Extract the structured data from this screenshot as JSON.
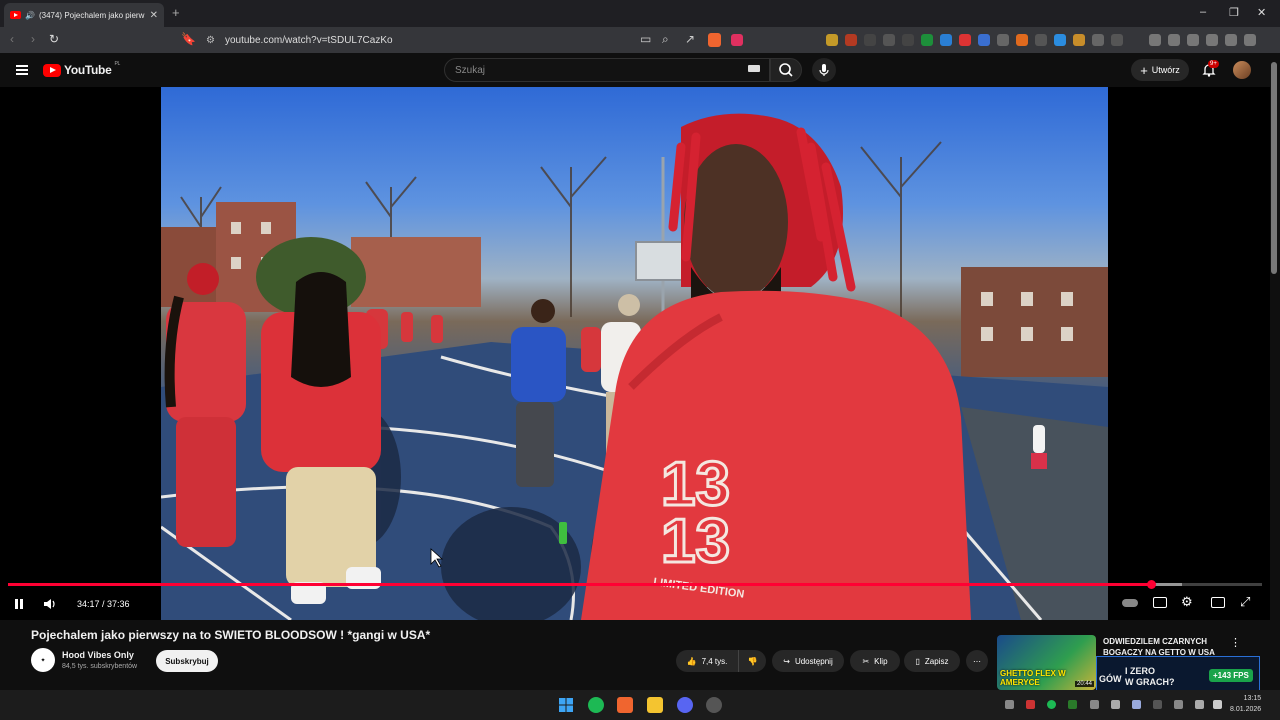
{
  "browser": {
    "tab_title": "(3474) Pojechalem jako pierw",
    "url": "youtube.com/watch?v=tSDUL7CazKo",
    "new_tab_icon": "plus-icon"
  },
  "youtube": {
    "logo_text": "YouTube",
    "logo_region": "PL",
    "search_placeholder": "Szukaj",
    "create_label": "Utwórz",
    "notification_badge": "9+"
  },
  "player": {
    "current_time": "34:17",
    "duration": "37:36",
    "time_display": "34:17 / 37:36",
    "progress_fraction": 0.9118,
    "buffered_fraction": 0.936,
    "jersey_text": "13",
    "shirt_tag": "LIMITED EDITION"
  },
  "video": {
    "title": "Pojechalem jako pierwszy na to SWIETO BLOODSOW ! *gangi w USA*",
    "channel_name": "Hood Vibes Only",
    "subscribers": "84,5 tys. subskrybentów",
    "subscribe_label": "Subskrybuj",
    "likes": "7,4 tys.",
    "share_label": "Udostępnij",
    "clip_label": "Klip",
    "save_label": "Zapisz"
  },
  "recommendation": {
    "title": "ODWIEDZILEM CZARNYCH BOGACZY NA GETTO W USA",
    "thumb_caption": "GHETTO FLEX W AMERYCE",
    "duration": "20:44"
  },
  "overlay": {
    "left_text": "GÓW",
    "mid_text_1": "I  ZERO",
    "mid_text_2": "W  GRACH?",
    "fps_text": "+143 FPS"
  },
  "taskbar": {
    "time": "13:15",
    "date": "8.01.2026"
  },
  "colors": {
    "youtube_red": "#ff0000",
    "progress_red": "#ff0033",
    "hoodie_red": "#e2393f"
  }
}
